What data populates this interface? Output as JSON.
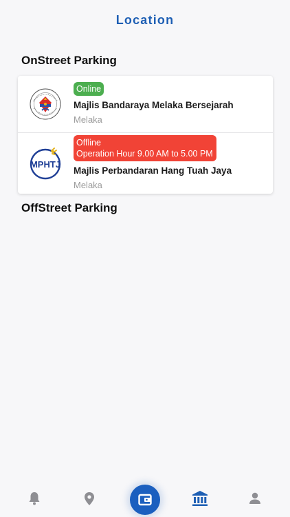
{
  "header": {
    "title": "Location"
  },
  "sections": {
    "onstreet_title": "OnStreet Parking",
    "offstreet_title": "OffStreet Parking"
  },
  "onstreet": [
    {
      "status": "Online",
      "name": "Majlis Bandaraya Melaka Bersejarah",
      "location": "Melaka",
      "logo": "mbmb-logo"
    },
    {
      "status": "Offline",
      "status_detail": "Operation Hour 9.00 AM to 5.00 PM",
      "name": "Majlis Perbandaran Hang Tuah Jaya",
      "location": "Melaka",
      "logo": "mphtj-logo",
      "logo_text": "MPHTJ"
    }
  ],
  "bottom_nav": [
    {
      "icon": "bell-icon",
      "active": false
    },
    {
      "icon": "location-pin-icon",
      "active": false
    },
    {
      "icon": "wallet-icon",
      "active": true,
      "center": true
    },
    {
      "icon": "bank-icon",
      "active": true
    },
    {
      "icon": "person-icon",
      "active": false
    }
  ],
  "colors": {
    "primary": "#1e5fb4",
    "online": "#4cae4f",
    "offline": "#f14336",
    "inactive_icon": "#8e8e93"
  }
}
